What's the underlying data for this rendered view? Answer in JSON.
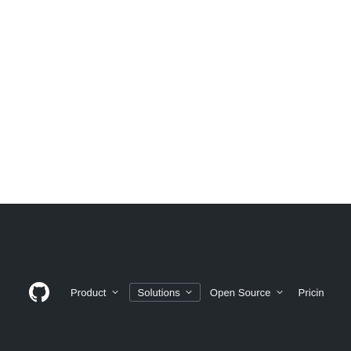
{
  "colors": {
    "page_bg": "#ffffff",
    "navbar_bg": "#23282d",
    "nav_text": "#eef1f4",
    "active_border": "#5e656d"
  },
  "header": {
    "logo_icon": "github-logo-icon",
    "nav": [
      {
        "label": "Product",
        "has_dropdown": true
      },
      {
        "label": "Solutions",
        "has_dropdown": true,
        "active": true
      },
      {
        "label": "Open Source",
        "has_dropdown": true
      },
      {
        "label": "Pricin",
        "has_dropdown": false
      }
    ]
  }
}
